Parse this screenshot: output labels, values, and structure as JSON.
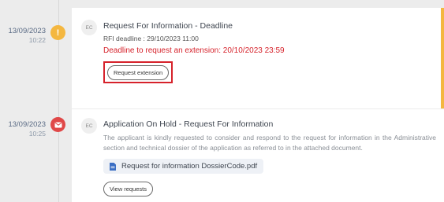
{
  "entries": [
    {
      "date": "13/09/2023",
      "time": "10:22",
      "status_icon": "exclamation-icon",
      "status_color": "#f4b740",
      "avatar": "EC",
      "title": "Request For Information - Deadline",
      "rfi_deadline": "RFI deadline : 29/10/2023 11:00",
      "extension_deadline": "Deadline to request an extension: 20/10/2023 23:59",
      "button": "Request extension"
    },
    {
      "date": "13/09/2023",
      "time": "10:25",
      "status_icon": "envelope-icon",
      "status_color": "#e04848",
      "avatar": "EC",
      "title": "Application On Hold - Request For Information",
      "description": "The applicant is kindly requested to consider and respond to the request for information in the Administrative section and technical dossier of the application as referred to in the attached document.",
      "attachment": "Request for information DossierCode.pdf",
      "button": "View requests"
    }
  ],
  "colors": {
    "accent_yellow": "#f4b740",
    "accent_red": "#d6222b",
    "envelope_red": "#e04848"
  }
}
